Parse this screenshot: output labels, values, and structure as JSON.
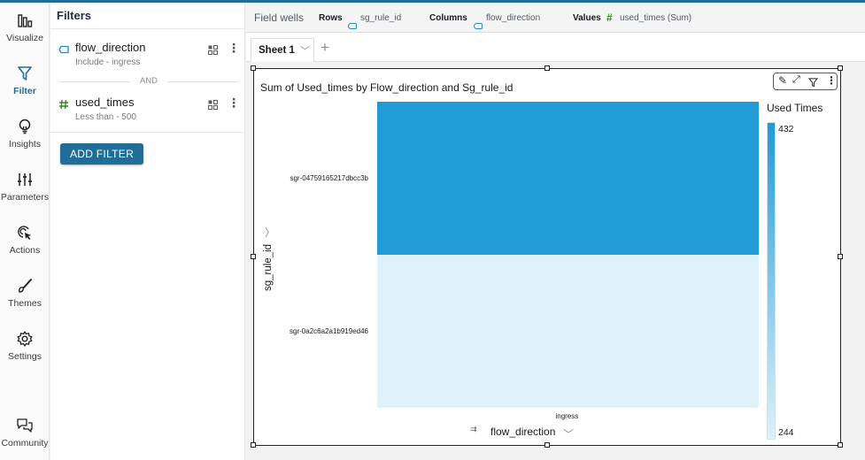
{
  "rail": {
    "items": [
      {
        "label": "Visualize",
        "icon": "bar-chart-icon",
        "active": false
      },
      {
        "label": "Filter",
        "icon": "filter-icon",
        "active": true
      },
      {
        "label": "Insights",
        "icon": "lightbulb-icon",
        "active": false
      },
      {
        "label": "Parameters",
        "icon": "sliders-icon",
        "active": false
      },
      {
        "label": "Actions",
        "icon": "cursor-click-icon",
        "active": false
      },
      {
        "label": "Themes",
        "icon": "brush-icon",
        "active": false
      },
      {
        "label": "Settings",
        "icon": "gear-icon",
        "active": false
      },
      {
        "label": "Community",
        "icon": "chat-bubbles-icon",
        "active": false
      }
    ]
  },
  "filters": {
    "title": "Filters",
    "items": [
      {
        "field": "flow_direction",
        "type": "dimension",
        "description": "Include - ingress"
      },
      {
        "field": "used_times",
        "type": "measure",
        "description": "Less than - 500"
      }
    ],
    "separator": "AND",
    "add_label": "ADD FILTER"
  },
  "field_wells": {
    "title": "Field wells",
    "rows_label": "Rows",
    "rows_value": "sg_rule_id",
    "columns_label": "Columns",
    "columns_value": "flow_direction",
    "values_label": "Values",
    "values_value": "used_times (Sum)"
  },
  "sheets": {
    "tabs": [
      {
        "label": "Sheet 1",
        "active": true
      }
    ],
    "add_icon": "+"
  },
  "visual": {
    "title": "Sum of Used_times by Flow_direction and Sg_rule_id",
    "toolbar": [
      "edit-icon",
      "expand-icon",
      "filter-icon",
      "more-icon"
    ]
  },
  "colors": {
    "accent": "#1f6d98",
    "heat_high": "#209bd6",
    "heat_low": "#dff1fb",
    "measure_green": "#2e8b1f",
    "dimension_blue": "#1f8ace"
  },
  "chart_data": {
    "type": "heatmap",
    "title": "Sum of Used_times by Flow_direction and Sg_rule_id",
    "xlabel": "flow_direction",
    "ylabel": "sg_rule_id",
    "x": [
      "ingress"
    ],
    "y": [
      "sgr-04759165217dbcc3b",
      "sgr-0a2c6a2a1b919ed46"
    ],
    "values": [
      [
        432
      ],
      [
        244
      ]
    ],
    "legend": {
      "title": "Used Times",
      "max": 432,
      "min": 244,
      "placement": "right"
    }
  }
}
